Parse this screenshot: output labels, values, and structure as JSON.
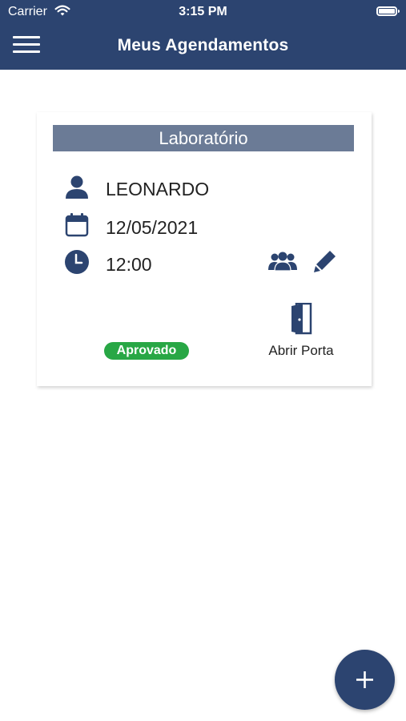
{
  "status_bar": {
    "carrier": "Carrier",
    "time": "3:15 PM"
  },
  "header": {
    "title": "Meus Agendamentos"
  },
  "appointment": {
    "location": "Laboratório",
    "name": "LEONARDO",
    "date": "12/05/2021",
    "time": "12:00",
    "status": "Aprovado",
    "door_action_label": "Abrir Porta"
  },
  "colors": {
    "primary": "#2c4470",
    "card_title_bg": "#6b7b96",
    "status_approved": "#28a745"
  },
  "icons": [
    "menu-icon",
    "user-icon",
    "calendar-icon",
    "clock-icon",
    "group-icon",
    "pencil-icon",
    "door-icon",
    "plus-icon"
  ]
}
